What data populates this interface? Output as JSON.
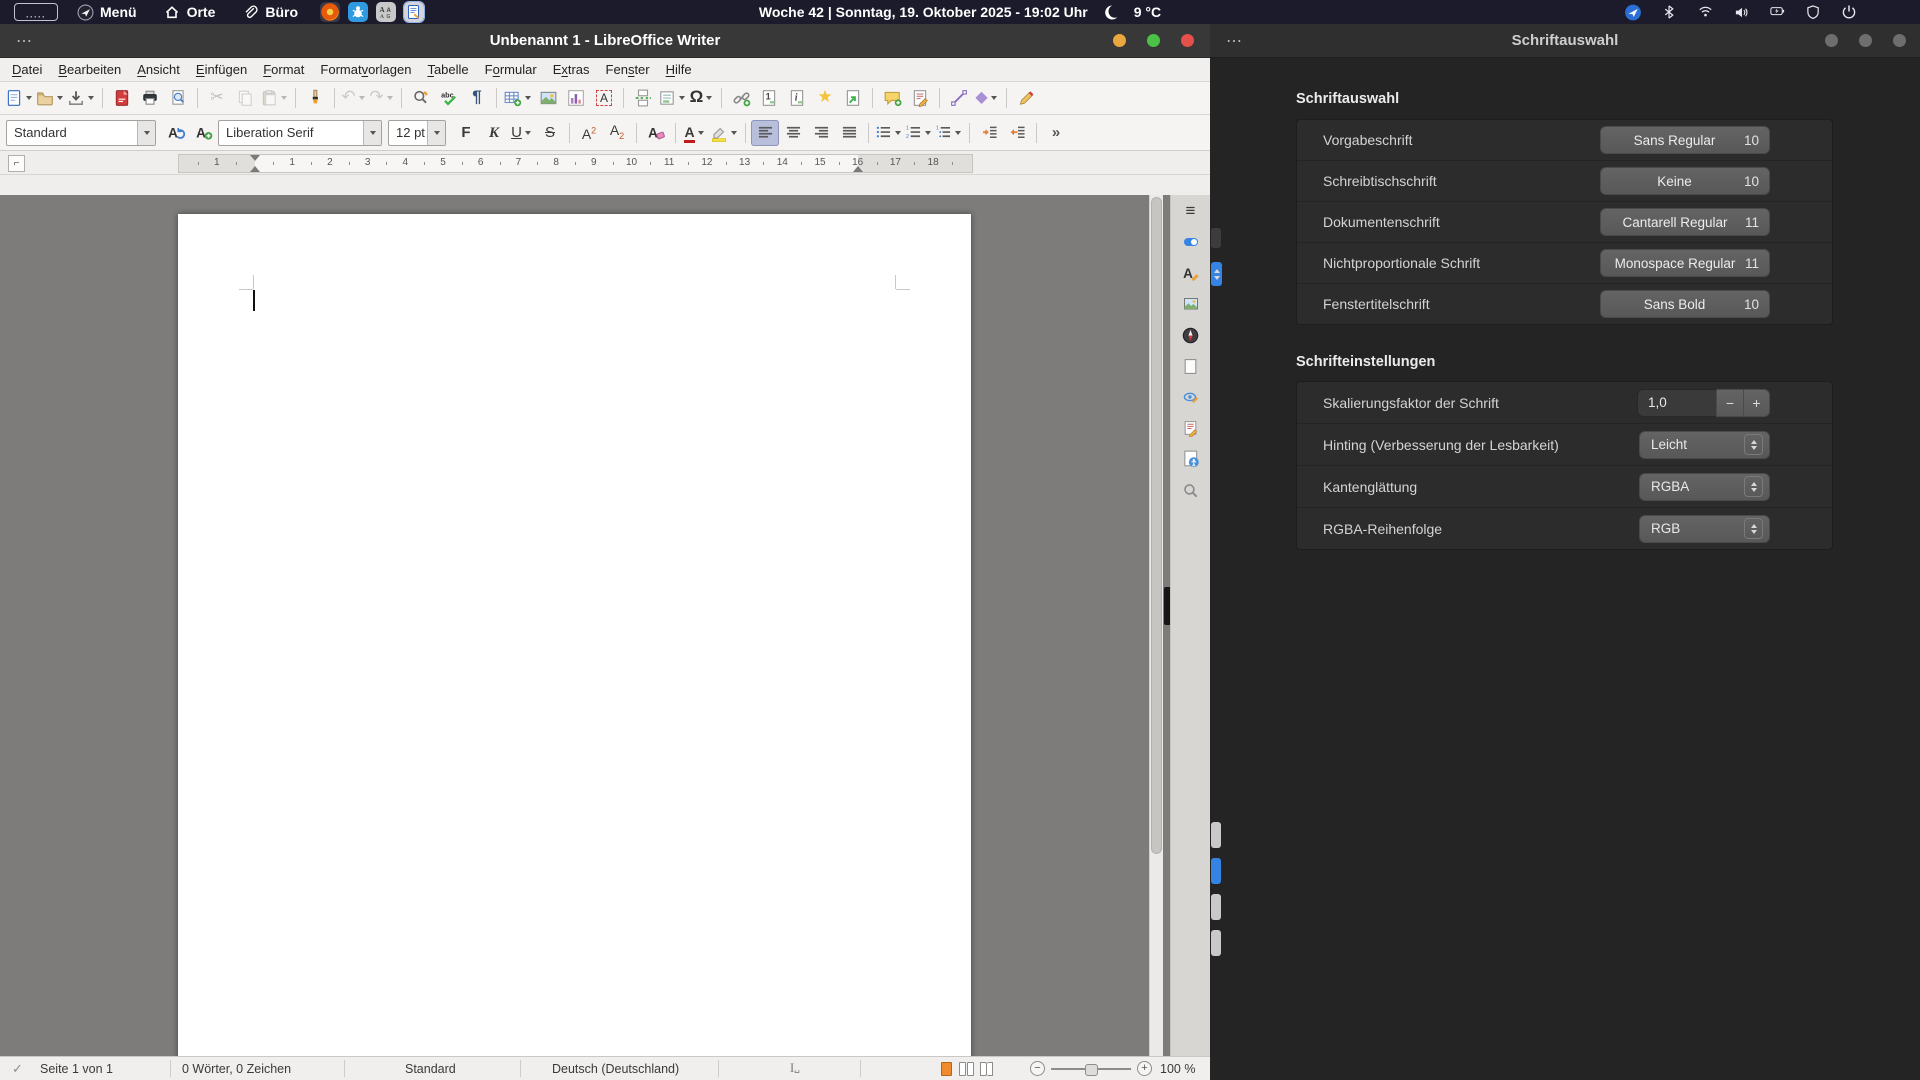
{
  "panel": {
    "menu_label": "Menü",
    "places_label": "Orte",
    "office_label": "Büro",
    "clock": "Woche 42 | Sonntag, 19. Oktober 2025 - 19:02 Uhr",
    "temperature": "9 °C",
    "app_icons": [
      {
        "name": "firefox",
        "active": false
      },
      {
        "name": "package-app",
        "active": false
      },
      {
        "name": "fonts-app",
        "active": false
      },
      {
        "name": "writer-app",
        "active": true
      }
    ],
    "tray_icons": [
      "budgie-applet",
      "bluetooth",
      "wifi",
      "volume",
      "battery",
      "shield",
      "power"
    ]
  },
  "writer": {
    "title": "Unbenannt 1 - LibreOffice Writer",
    "overflow_dots": "⋯",
    "menus": [
      {
        "label": "Datei",
        "u": 0
      },
      {
        "label": "Bearbeiten",
        "u": 0
      },
      {
        "label": "Ansicht",
        "u": 0
      },
      {
        "label": "Einfügen",
        "u": 0
      },
      {
        "label": "Format",
        "u": 0
      },
      {
        "label": "Formatvorlagen",
        "u": 6
      },
      {
        "label": "Tabelle",
        "u": 0
      },
      {
        "label": "Formular",
        "u": 1
      },
      {
        "label": "Extras",
        "u": 1
      },
      {
        "label": "Fenster",
        "u": 3
      },
      {
        "label": "Hilfe",
        "u": 0
      }
    ],
    "toolbar": [
      {
        "name": "new-document",
        "dd": true
      },
      {
        "name": "open-folder",
        "dd": true
      },
      {
        "name": "save",
        "dd": true
      },
      {
        "sep": true
      },
      {
        "name": "export-pdf"
      },
      {
        "name": "print"
      },
      {
        "name": "print-preview"
      },
      {
        "sep": true
      },
      {
        "name": "cut",
        "disabled": true
      },
      {
        "name": "copy",
        "disabled": true
      },
      {
        "name": "paste",
        "disabled": true,
        "dd": true
      },
      {
        "sep": true
      },
      {
        "name": "clone-formatting"
      },
      {
        "sep": true
      },
      {
        "name": "undo",
        "disabled": true,
        "dd": true
      },
      {
        "name": "redo",
        "disabled": true,
        "dd": true
      },
      {
        "sep": true
      },
      {
        "name": "find-replace"
      },
      {
        "name": "spelling"
      },
      {
        "name": "formatting-marks"
      },
      {
        "sep": true
      },
      {
        "name": "insert-table",
        "dd": true
      },
      {
        "name": "insert-image"
      },
      {
        "name": "insert-chart"
      },
      {
        "name": "insert-textbox"
      },
      {
        "sep": true
      },
      {
        "name": "page-break"
      },
      {
        "name": "insert-field",
        "dd": true
      },
      {
        "name": "special-character",
        "dd": true
      },
      {
        "sep": true
      },
      {
        "name": "insert-hyperlink"
      },
      {
        "name": "insert-footnote"
      },
      {
        "name": "insert-endnote"
      },
      {
        "name": "insert-bookmark"
      },
      {
        "name": "insert-cross-reference"
      },
      {
        "sep": true
      },
      {
        "name": "insert-comment"
      },
      {
        "name": "track-changes"
      },
      {
        "sep": true
      },
      {
        "name": "insert-line"
      },
      {
        "name": "basic-shapes",
        "dd": true
      },
      {
        "sep": true
      },
      {
        "name": "draw-functions"
      }
    ],
    "format": {
      "style_value": "Standard",
      "font_value": "Liberation Serif",
      "size_value": "12 pt",
      "buttons": [
        {
          "name": "update-style"
        },
        {
          "name": "new-style"
        },
        {
          "combo": "font"
        },
        {
          "combo": "size"
        },
        {
          "name": "bold"
        },
        {
          "name": "italic"
        },
        {
          "name": "underline",
          "dd": true
        },
        {
          "name": "strikethrough"
        },
        {
          "sep": true
        },
        {
          "name": "superscript"
        },
        {
          "name": "subscript"
        },
        {
          "sep": true
        },
        {
          "name": "clear-formatting"
        },
        {
          "sep": true
        },
        {
          "name": "font-color",
          "dd": true
        },
        {
          "name": "highlight-color",
          "dd": true
        },
        {
          "sep": true
        },
        {
          "name": "align-left",
          "active": true
        },
        {
          "name": "align-center"
        },
        {
          "name": "align-right"
        },
        {
          "name": "align-justify"
        },
        {
          "sep": true
        },
        {
          "name": "bullet-list",
          "dd": true
        },
        {
          "name": "numbered-list",
          "dd": true
        },
        {
          "name": "outline-list",
          "dd": true
        },
        {
          "sep": true
        },
        {
          "name": "increase-indent"
        },
        {
          "name": "decrease-indent"
        },
        {
          "sep": true
        },
        {
          "name": "toolbar-overflow"
        }
      ]
    },
    "ruler": {
      "left_numbers": [
        "1"
      ],
      "numbers": [
        "1",
        "2",
        "3",
        "4",
        "5",
        "6",
        "7",
        "8",
        "9",
        "10",
        "11",
        "12",
        "13",
        "14",
        "15",
        "16",
        "17",
        "18"
      ]
    },
    "sidebar_tabs": [
      "sidebar-menu",
      "properties",
      "styles",
      "gallery",
      "navigator",
      "page",
      "style-inspector",
      "manage-changes",
      "accessibility-check",
      "find"
    ],
    "statusbar": {
      "page": "Seite 1 von 1",
      "words": "0 Wörter, 0 Zeichen",
      "style": "Standard",
      "language": "Deutsch (Deutschland)",
      "zoom": "100 %"
    }
  },
  "fontdialog": {
    "title": "Schriftauswahl",
    "overflow_dots": "⋯",
    "section_fonts": {
      "heading": "Schriftauswahl",
      "rows": [
        {
          "label": "Vorgabeschrift",
          "font": "Sans Regular",
          "size": "10"
        },
        {
          "label": "Schreibtischschrift",
          "font": "Keine",
          "size": "10"
        },
        {
          "label": "Dokumentenschrift",
          "font": "Cantarell Regular",
          "size": "11"
        },
        {
          "label": "Nichtproportionale Schrift",
          "font": "Monospace Regular",
          "size": "11"
        },
        {
          "label": "Fenstertitelschrift",
          "font": "Sans Bold",
          "size": "10"
        }
      ]
    },
    "section_settings": {
      "heading": "Schrifteinstellungen",
      "scale_row": {
        "label": "Skalierungsfaktor der Schrift",
        "value": "1,0",
        "minus": "−",
        "plus": "+"
      },
      "dropdown_rows": [
        {
          "label": "Hinting (Verbesserung der Lesbarkeit)",
          "value": "Leicht"
        },
        {
          "label": "Kantenglättung",
          "value": "RGBA"
        },
        {
          "label": "RGBA-Reihenfolge",
          "value": "RGB"
        }
      ]
    }
  },
  "colors": {
    "accent": "#3584e4",
    "active_page_icon": "#f08a2d",
    "close": "#e4504a",
    "max": "#4cc147",
    "min": "#eaa63f"
  }
}
